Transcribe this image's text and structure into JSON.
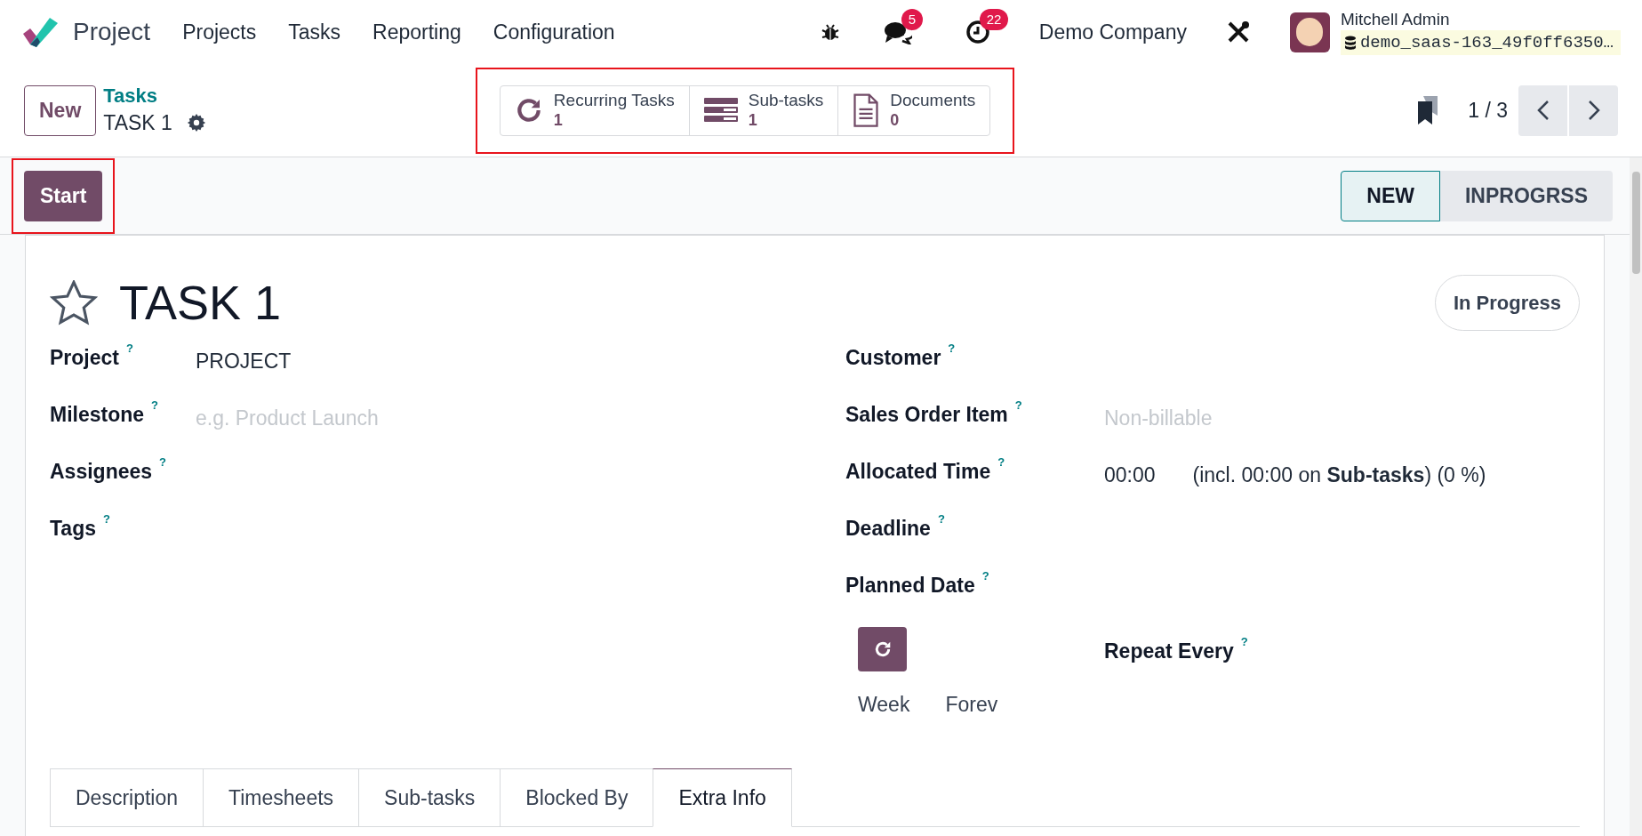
{
  "navbar": {
    "app_name": "Project",
    "menu": [
      {
        "label": "Projects"
      },
      {
        "label": "Tasks"
      },
      {
        "label": "Reporting"
      },
      {
        "label": "Configuration"
      }
    ],
    "messages_count": "5",
    "activities_count": "22",
    "company": "Demo Company",
    "user": {
      "name": "Mitchell Admin",
      "database": "demo_saas-163_49f0ff6350…"
    }
  },
  "control_panel": {
    "new_button": "New",
    "breadcrumb": "Tasks",
    "record_name": "TASK 1",
    "smart_buttons": [
      {
        "kind": "recurring",
        "label": "Recurring Tasks",
        "count": "1"
      },
      {
        "kind": "subtasks",
        "label": "Sub-tasks",
        "count": "1"
      },
      {
        "kind": "documents",
        "label": "Documents",
        "count": "0"
      }
    ],
    "pager": "1 / 3"
  },
  "status_bar": {
    "start_button": "Start",
    "stages": [
      {
        "label": "NEW",
        "selected": true
      },
      {
        "label": "INPROGRSS",
        "selected": false
      }
    ]
  },
  "form": {
    "starred": false,
    "title": "TASK 1",
    "state": "In Progress",
    "left_fields": [
      {
        "label": "Project",
        "help": "?",
        "value": "PROJECT"
      },
      {
        "label": "Milestone",
        "help": "?",
        "placeholder": "e.g. Product Launch"
      },
      {
        "label": "Assignees",
        "help": "?"
      },
      {
        "label": "Tags",
        "help": "?"
      }
    ],
    "right_fields": [
      {
        "label": "Customer",
        "help": "?"
      },
      {
        "label": "Sales Order Item",
        "help": "?",
        "placeholder": "Non-billable"
      },
      {
        "label": "Allocated Time",
        "help": "?",
        "value": "00:00",
        "note": "(incl. 00:00 on **Sub-tasks**) (0 %)"
      },
      {
        "label": "Deadline",
        "help": "?"
      },
      {
        "label": "Planned Date",
        "help": "?"
      }
    ],
    "recurrence": {
      "repeat_label": "Repeat Every",
      "help": "?",
      "unit": "Week",
      "until": "Forev"
    },
    "tabs": [
      {
        "label": "Description",
        "selected": false
      },
      {
        "label": "Timesheets",
        "selected": false
      },
      {
        "label": "Sub-tasks",
        "selected": false
      },
      {
        "label": "Blocked By",
        "selected": false
      },
      {
        "label": "Extra Info",
        "selected": true
      }
    ]
  }
}
